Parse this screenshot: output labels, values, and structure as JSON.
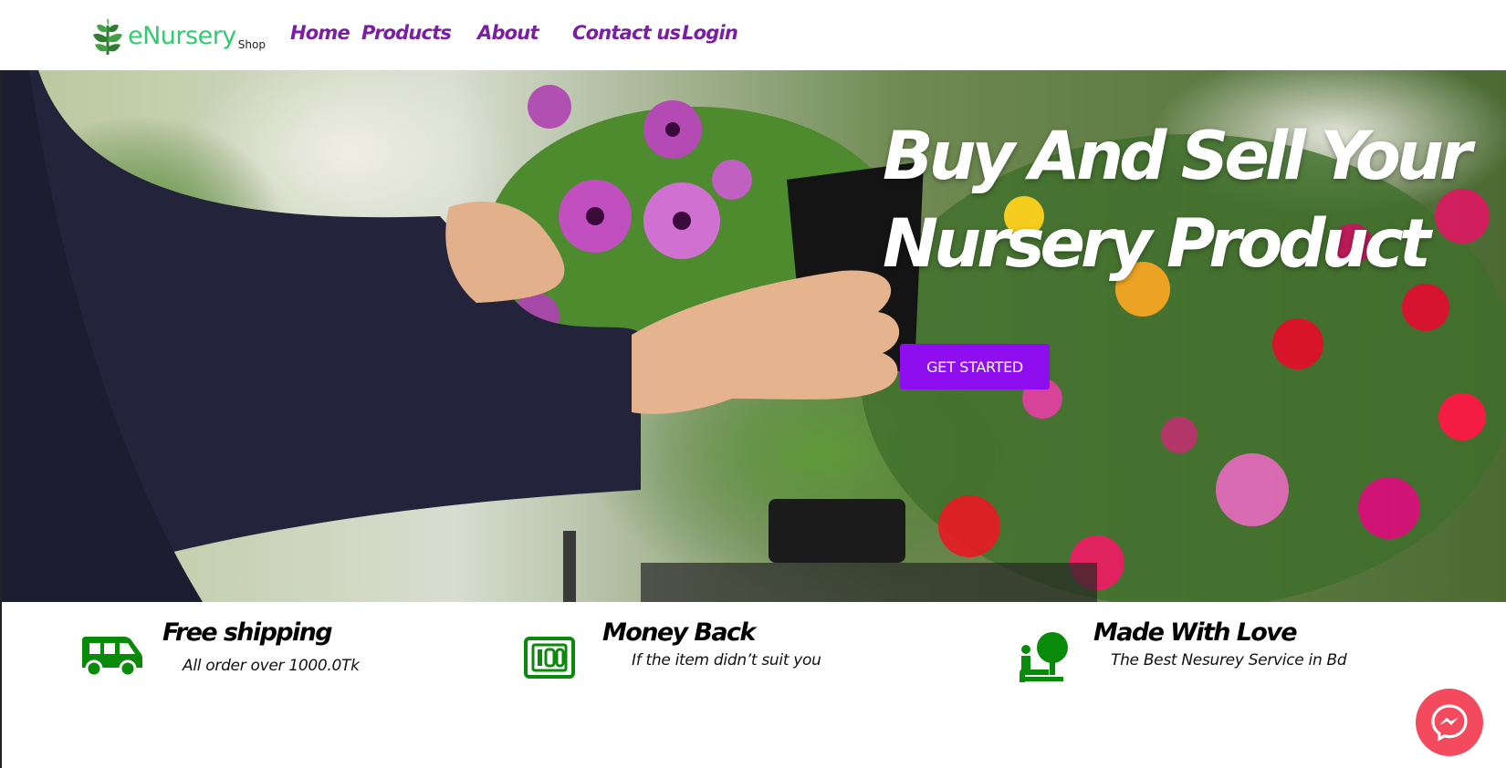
{
  "brand": {
    "name": "eNursery",
    "suffix": "Shop",
    "logo_icon": "leaf-plant-icon",
    "color": "#2ecc71"
  },
  "nav": {
    "link_color": "#7b1fa2",
    "links": [
      {
        "label": "Home"
      },
      {
        "label": "Products"
      },
      {
        "label": "About"
      },
      {
        "label": "Contact us"
      },
      {
        "label": "Login"
      }
    ]
  },
  "hero": {
    "title_line1": "Buy And Sell Your",
    "title_line2": "Nursery Product",
    "cta_label": "GET STARTED",
    "cta_color": "#8e0ef0"
  },
  "features": [
    {
      "title": "Free shipping",
      "subtitle": "All order over 1000.0Tk",
      "icon": "delivery-van-icon"
    },
    {
      "title": "Money Back",
      "subtitle": "If the item didn’t suit you",
      "icon": "money-back-icon"
    },
    {
      "title": "Made With Love",
      "subtitle": "The Best Nesurey Service in Bd",
      "icon": "tree-care-icon"
    }
  ],
  "feature_icon_color": "#0a8a0a",
  "chat": {
    "icon": "messenger-icon",
    "color": "#f44a5e"
  }
}
